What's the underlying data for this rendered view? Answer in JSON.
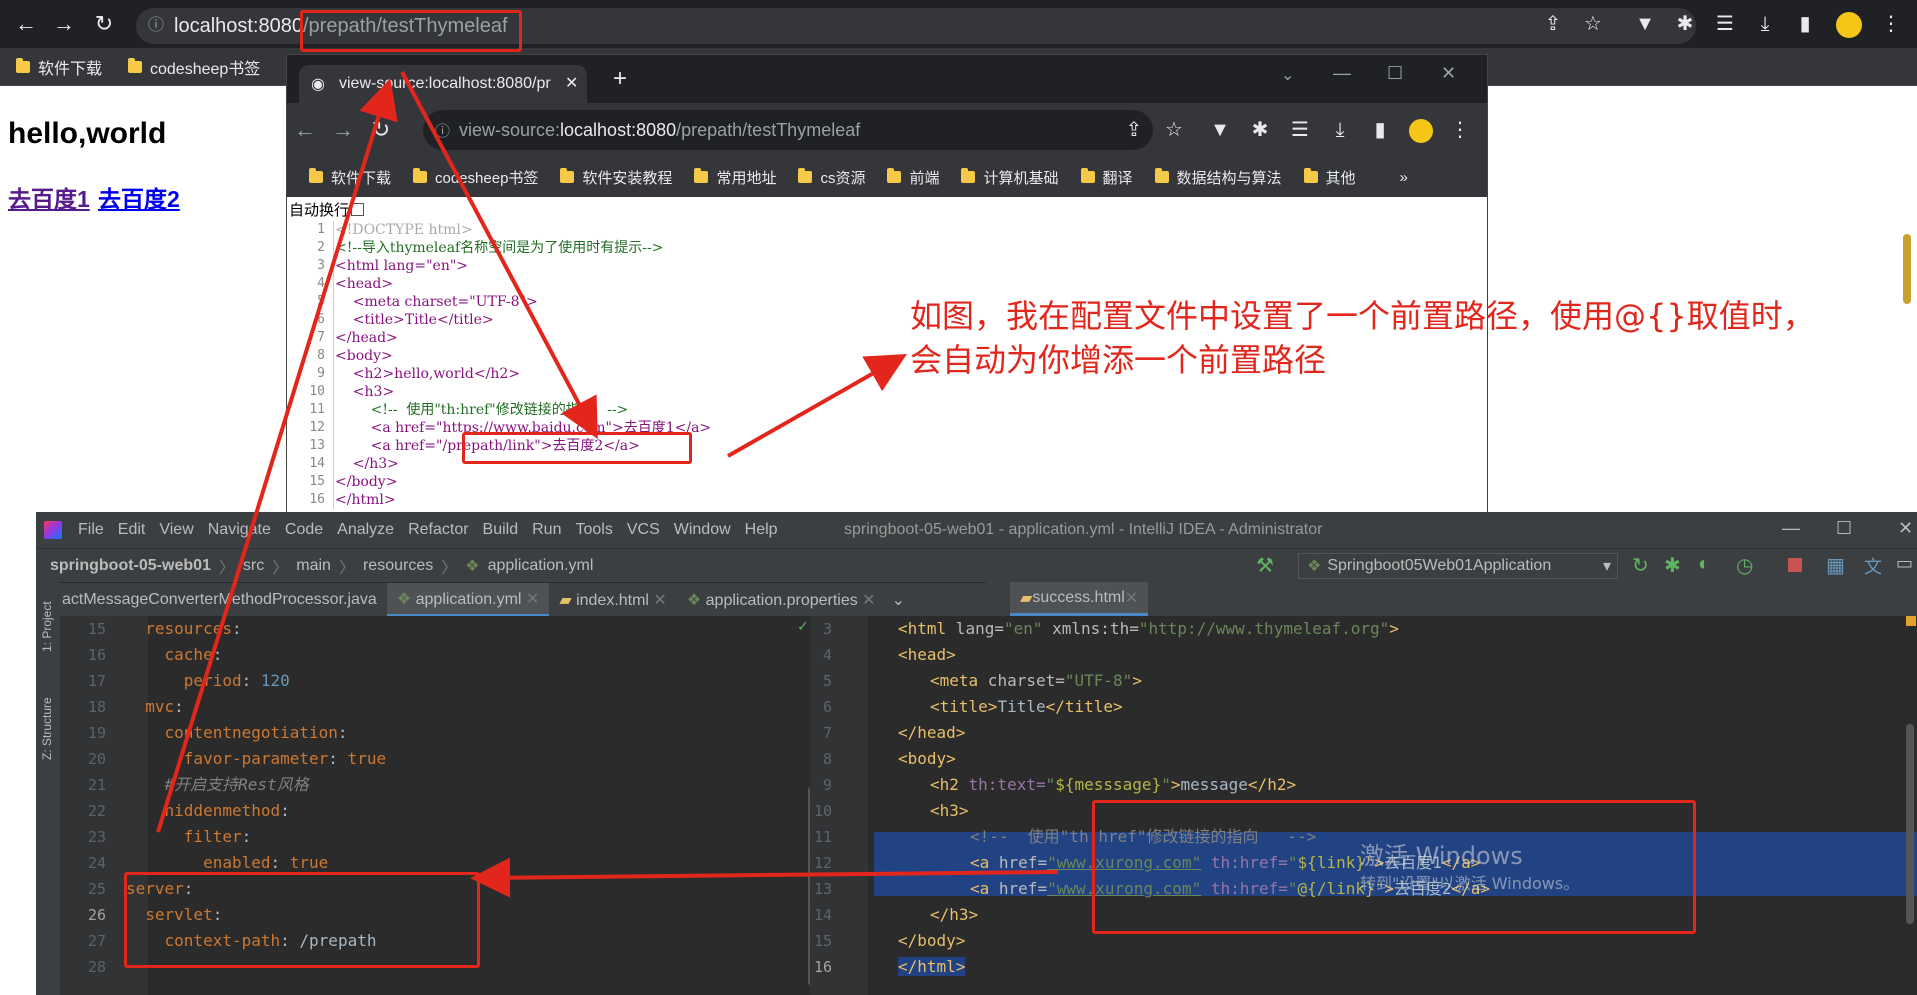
{
  "browser": {
    "url_host": "localhost:8080",
    "url_path": "/prepath/testThymeleaf",
    "bookmarks": [
      "软件下载",
      "codesheep书签"
    ]
  },
  "page": {
    "heading": "hello,world",
    "link1": "去百度1",
    "link2": "去百度2"
  },
  "view_source": {
    "tab_title": "view-source:localhost:8080/pr",
    "url_prefix": "view-source:",
    "url_host": "localhost:8080",
    "url_path": "/prepath/testThymeleaf",
    "bookmarks": [
      "软件下载",
      "codesheep书签",
      "软件安装教程",
      "常用地址",
      "cs资源",
      "前端",
      "计算机基础",
      "翻译",
      "数据结构与算法",
      "其他"
    ],
    "more_label": "»",
    "wrap_label": "自动换行",
    "lines": [
      "<!DOCTYPE html>",
      "<!--导入thymeleaf名称空间是为了使用时有提示-->",
      "<html lang=\"en\">",
      "<head>",
      "    <meta charset=\"UTF-8\">",
      "    <title>Title</title>",
      "</head>",
      "<body>",
      "    <h2>hello,world</h2>",
      "    <h3>",
      "        <!--  使用\"th:href\"修改链接的指向   -->",
      "        <a href=\"https://www.baidu.com\">去百度1</a>",
      "        <a href=\"/prepath/link\">去百度2</a>",
      "    </h3>",
      "</body>",
      "</html>"
    ]
  },
  "annotation": {
    "line1": "如图，我在配置文件中设置了一个前置路径，使用@{}取值时，",
    "line2": "会自动为你增添一个前置路径"
  },
  "ide": {
    "menu": [
      "File",
      "Edit",
      "View",
      "Navigate",
      "Code",
      "Analyze",
      "Refactor",
      "Build",
      "Run",
      "Tools",
      "VCS",
      "Window",
      "Help"
    ],
    "title": "springboot-05-web01 - application.yml - IntelliJ IDEA - Administrator",
    "breadcrumb": [
      "springboot-05-web01",
      "src",
      "main",
      "resources",
      "application.yml"
    ],
    "run_config": "Springboot05Web01Application",
    "tabs_left": [
      "actMessageConverterMethodProcessor.java",
      "application.yml",
      "index.html",
      "application.properties"
    ],
    "tabs_right": [
      "success.html"
    ],
    "side_labels": [
      "1: Project",
      "Z: Structure"
    ],
    "yaml_lines": [
      {
        "n": "15",
        "indent": "  ",
        "key": "resources",
        "val": ""
      },
      {
        "n": "16",
        "indent": "    ",
        "key": "cache",
        "val": ""
      },
      {
        "n": "17",
        "indent": "      ",
        "key": "period",
        "val": "120"
      },
      {
        "n": "18",
        "indent": "  ",
        "key": "mvc",
        "val": ""
      },
      {
        "n": "19",
        "indent": "    ",
        "key": "contentnegotiation",
        "val": ""
      },
      {
        "n": "20",
        "indent": "      ",
        "key": "favor-parameter",
        "val": "true"
      },
      {
        "n": "21",
        "indent": "    ",
        "key": "",
        "val": "",
        "comment": "#开启支持Rest风格"
      },
      {
        "n": "22",
        "indent": "    ",
        "key": "hiddenmethod",
        "val": ""
      },
      {
        "n": "23",
        "indent": "      ",
        "key": "filter",
        "val": ""
      },
      {
        "n": "24",
        "indent": "        ",
        "key": "enabled",
        "val": "true"
      },
      {
        "n": "25",
        "indent": "",
        "key": "server",
        "val": ""
      },
      {
        "n": "26",
        "indent": "  ",
        "key": "servlet",
        "val": ""
      },
      {
        "n": "27",
        "indent": "    ",
        "key": "context-path",
        "val": "/prepath"
      },
      {
        "n": "28",
        "indent": "",
        "key": "",
        "val": ""
      }
    ],
    "html_line_numbers": [
      "3",
      "4",
      "5",
      "6",
      "7",
      "8",
      "9",
      "10",
      "11",
      "12",
      "13",
      "14",
      "15",
      "16"
    ],
    "html": {
      "l3_tag": "<html",
      "l3_attr1": " lang=",
      "l3_val1": "\"en\"",
      "l3_attr2": " xmlns:th=",
      "l3_val2": "\"http://www.thymeleaf.org\"",
      "l3_end": ">",
      "l4": "<head>",
      "l5_tag": "<meta",
      "l5_attr": " charset=",
      "l5_val": "\"UTF-8\"",
      "l5_end": ">",
      "l6_open": "<title>",
      "l6_text": "Title",
      "l6_close": "</title>",
      "l7": "</head>",
      "l8": "<body>",
      "l9_tag": "<h2 ",
      "l9_attr": "th:text=",
      "l9_q1": "\"",
      "l9_expr": "${messsage}",
      "l9_q2": "\"",
      "l9_end": ">",
      "l9_text": "message",
      "l9_close": "</h2>",
      "l10": "<h3>",
      "l11": "<!--  使用\"th:href\"修改链接的指向   -->",
      "l12_tag": "<a ",
      "l12_attr1": "href=",
      "l12_val1": "\"www.xurong.com\"",
      "l12_attr2": " th:href=",
      "l12_q1": "\"",
      "l12_expr": "${link}",
      "l12_q2": "\"",
      "l12_end": ">",
      "l12_text": "去百度1",
      "l12_close": "</a>",
      "l13_tag": "<a ",
      "l13_attr1": "href=",
      "l13_val1": "\"www.xurong.com\"",
      "l13_attr2": " th:href=",
      "l13_q1": "\"",
      "l13_expr": "@{/link}",
      "l13_q2": "\"",
      "l13_end": ">",
      "l13_text": "去百度2",
      "l13_close": "</a>",
      "l14": "</h3>",
      "l15": "</body>",
      "l16": "</html>"
    },
    "watermark1": "激活 Windows",
    "watermark2": "转到\"设置\"以激活 Windows。"
  },
  "colors": {
    "annotation_red": "#e3261c",
    "chrome_dark": "#202124",
    "ide_bg": "#2b2b2b",
    "selection": "#214283"
  }
}
